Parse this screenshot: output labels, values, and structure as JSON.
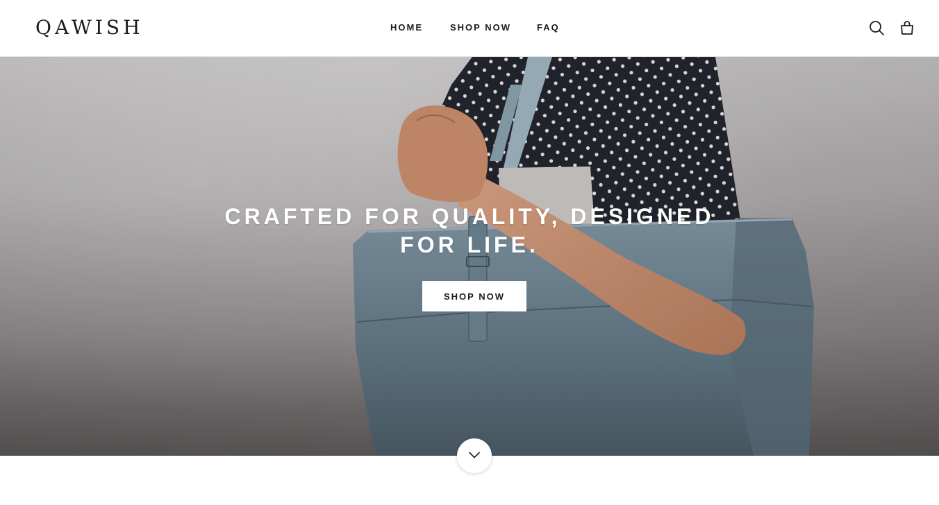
{
  "brand": {
    "logo_text": "QAWISH"
  },
  "nav": {
    "items": [
      {
        "label": "HOME"
      },
      {
        "label": "SHOP NOW"
      },
      {
        "label": "FAQ"
      }
    ]
  },
  "header_icons": {
    "search": "search-icon",
    "cart": "shopping-bag-icon"
  },
  "hero": {
    "heading_line1": "CRAFTED FOR QUALITY, DESIGNED",
    "heading_line2": "FOR LIFE.",
    "cta_label": "SHOP NOW",
    "image_alt": "woman in polka-dot blouse carrying a blue-grey leather tote bag"
  },
  "scroll_button": {
    "icon": "chevron-down-icon"
  },
  "colors": {
    "text": "#1c1c1c",
    "background": "#ffffff",
    "hero_text": "#ffffff",
    "bag": "#6f8593",
    "blouse": "#23252f"
  }
}
